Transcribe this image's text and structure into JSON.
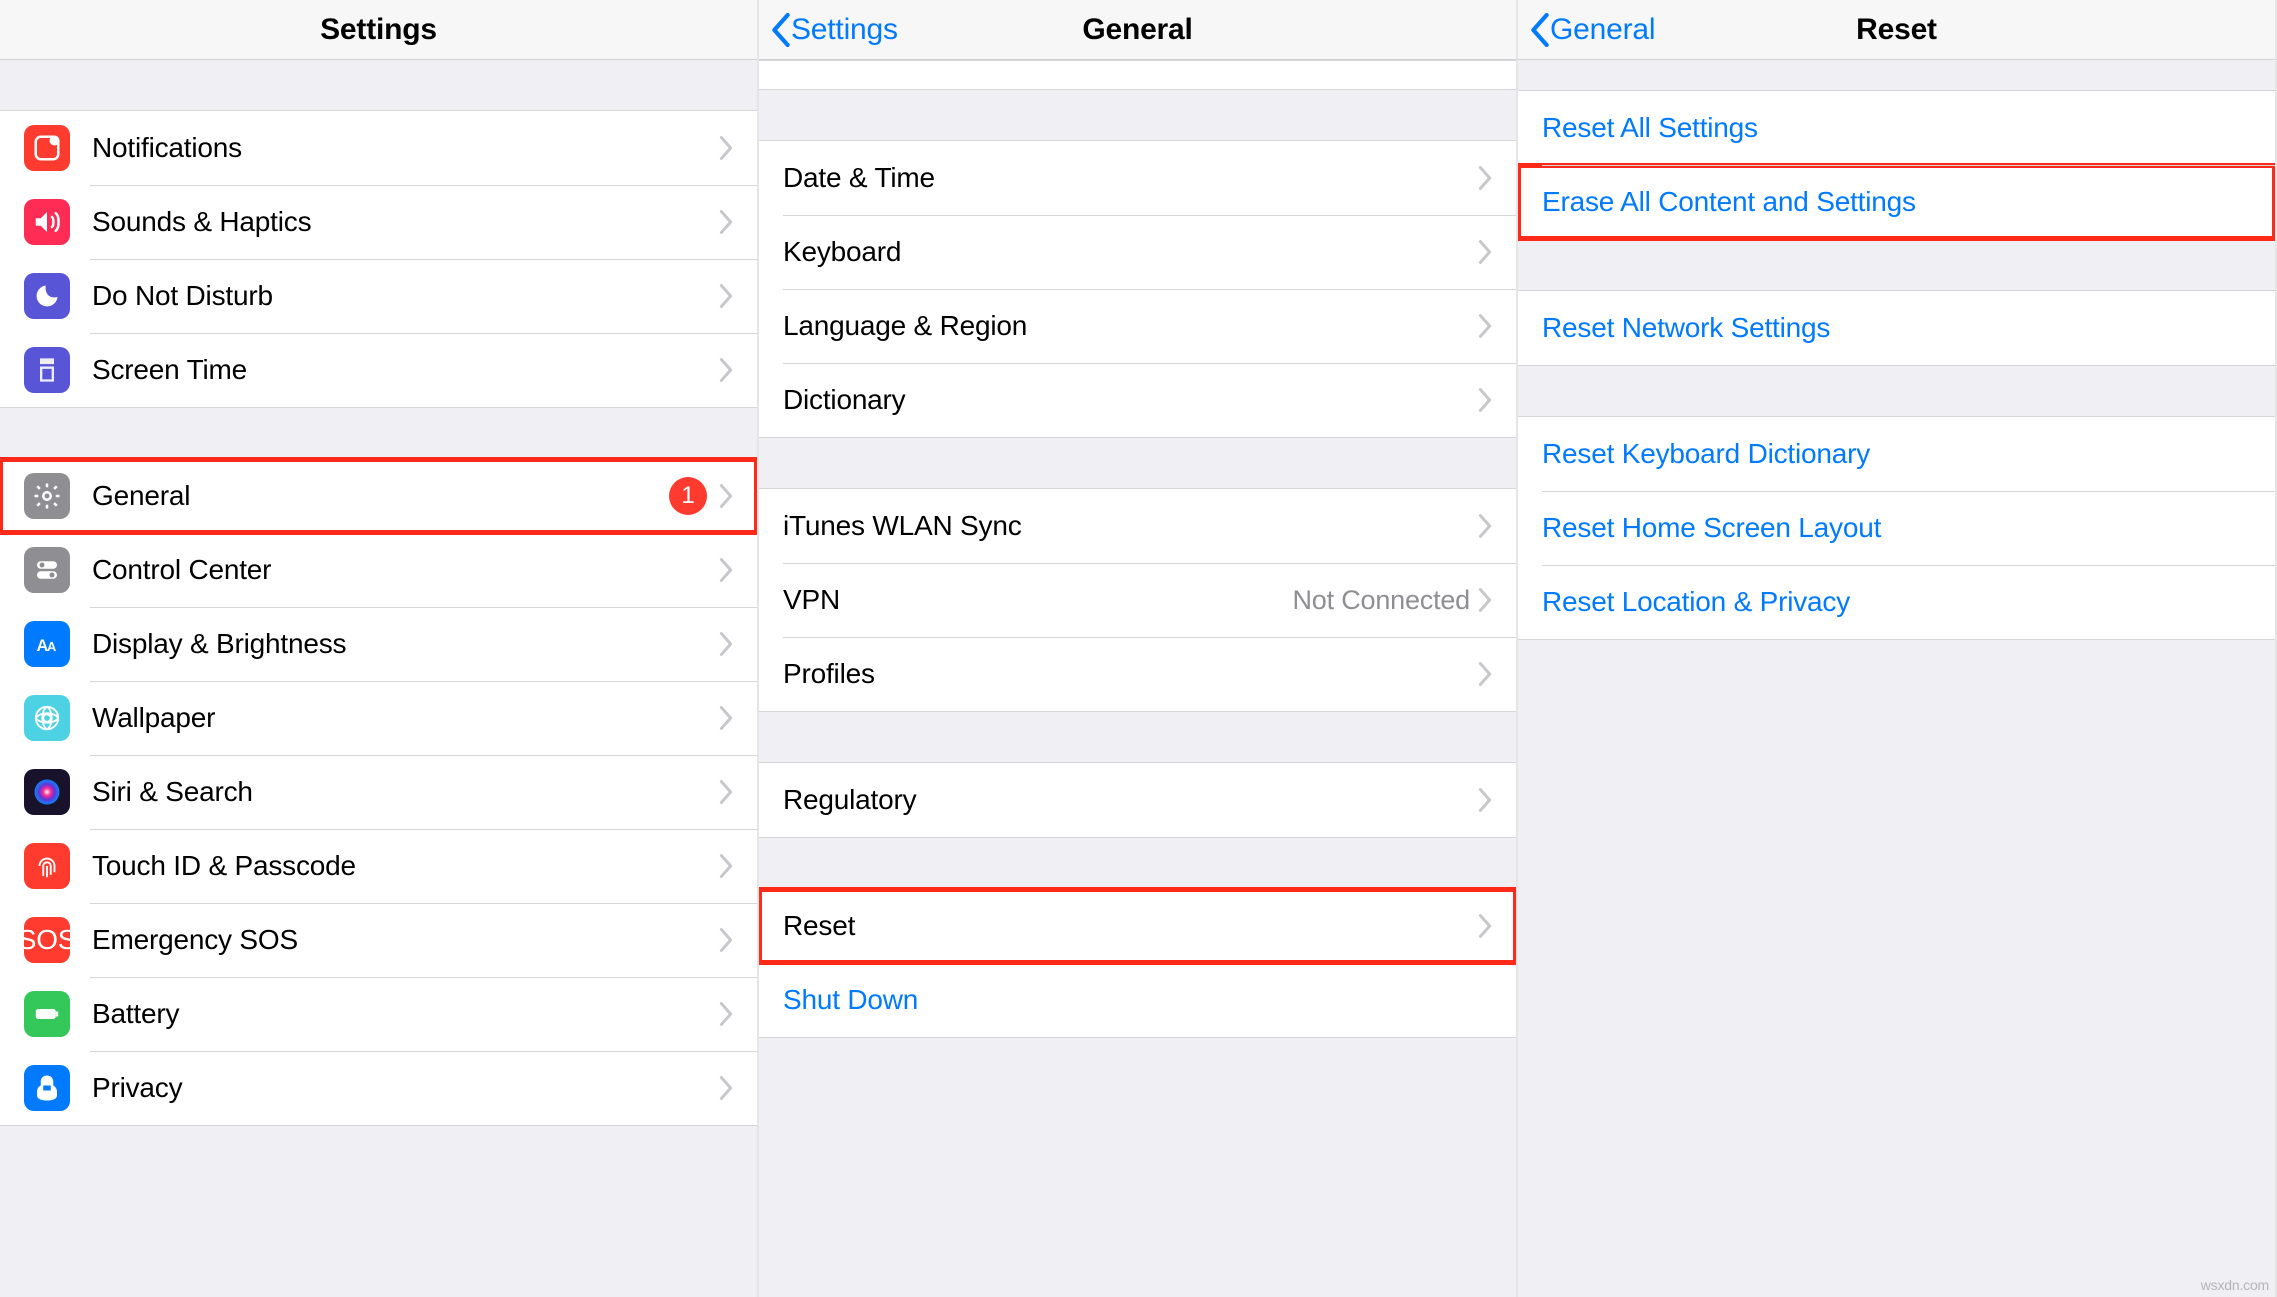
{
  "panel1": {
    "title": "Settings",
    "groups": [
      [
        {
          "icon": "notifications",
          "bg": "#ff3b30",
          "label": "Notifications"
        },
        {
          "icon": "sounds",
          "bg": "#ff2d55",
          "label": "Sounds & Haptics"
        },
        {
          "icon": "dnd",
          "bg": "#5856d6",
          "label": "Do Not Disturb"
        },
        {
          "icon": "screentime",
          "bg": "#5856d6",
          "label": "Screen Time"
        }
      ],
      [
        {
          "icon": "general",
          "bg": "#8e8e93",
          "label": "General",
          "badge": "1",
          "highlight": true
        },
        {
          "icon": "control",
          "bg": "#8e8e93",
          "label": "Control Center"
        },
        {
          "icon": "display",
          "bg": "#007aff",
          "label": "Display & Brightness"
        },
        {
          "icon": "wallpaper",
          "bg": "#4cd2e2",
          "label": "Wallpaper"
        },
        {
          "icon": "siri",
          "bg": "#18122b",
          "label": "Siri & Search"
        },
        {
          "icon": "touchid",
          "bg": "#ff3b30",
          "label": "Touch ID & Passcode"
        },
        {
          "icon": "sos",
          "bg": "#ff3b30",
          "label": "Emergency SOS"
        },
        {
          "icon": "battery",
          "bg": "#34c759",
          "label": "Battery"
        },
        {
          "icon": "privacy",
          "bg": "#007aff",
          "label": "Privacy"
        }
      ]
    ]
  },
  "panel2": {
    "back": "Settings",
    "title": "General",
    "groups": [
      [
        {
          "label": "Date & Time"
        },
        {
          "label": "Keyboard"
        },
        {
          "label": "Language & Region"
        },
        {
          "label": "Dictionary"
        }
      ],
      [
        {
          "label": "iTunes WLAN Sync"
        },
        {
          "label": "VPN",
          "detail": "Not Connected"
        },
        {
          "label": "Profiles"
        }
      ],
      [
        {
          "label": "Regulatory"
        }
      ],
      [
        {
          "label": "Reset",
          "highlight": true
        },
        {
          "label": "Shut Down",
          "link": true,
          "noChevron": true
        }
      ]
    ]
  },
  "panel3": {
    "back": "General",
    "title": "Reset",
    "groups": [
      [
        {
          "label": "Reset All Settings",
          "link": true
        },
        {
          "label": "Erase All Content and Settings",
          "link": true,
          "highlight": true
        }
      ],
      [
        {
          "label": "Reset Network Settings",
          "link": true
        }
      ],
      [
        {
          "label": "Reset Keyboard Dictionary",
          "link": true
        },
        {
          "label": "Reset Home Screen Layout",
          "link": true
        },
        {
          "label": "Reset Location & Privacy",
          "link": true
        }
      ]
    ]
  },
  "watermark": "wsxdn.com"
}
